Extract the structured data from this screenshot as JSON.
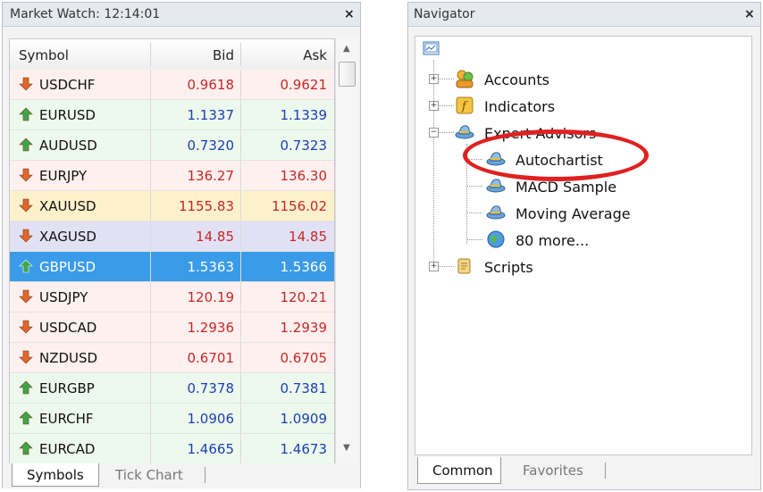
{
  "market_watch": {
    "title": "Market Watch: 12:14:01",
    "close_icon": "×",
    "columns": {
      "symbol": "Symbol",
      "bid": "Bid",
      "ask": "Ask"
    },
    "rows": [
      {
        "symbol": "USDCHF",
        "bid": "0.9618",
        "ask": "0.9621",
        "dir": "down"
      },
      {
        "symbol": "EURUSD",
        "bid": "1.1337",
        "ask": "1.1339",
        "dir": "up"
      },
      {
        "symbol": "AUDUSD",
        "bid": "0.7320",
        "ask": "0.7323",
        "dir": "up"
      },
      {
        "symbol": "EURJPY",
        "bid": "136.27",
        "ask": "136.30",
        "dir": "down"
      },
      {
        "symbol": "XAUUSD",
        "bid": "1155.83",
        "ask": "1156.02",
        "dir": "down"
      },
      {
        "symbol": "XAGUSD",
        "bid": "14.85",
        "ask": "14.85",
        "dir": "down"
      },
      {
        "symbol": "GBPUSD",
        "bid": "1.5363",
        "ask": "1.5366",
        "dir": "up"
      },
      {
        "symbol": "USDJPY",
        "bid": "120.19",
        "ask": "120.21",
        "dir": "down"
      },
      {
        "symbol": "USDCAD",
        "bid": "1.2936",
        "ask": "1.2939",
        "dir": "down"
      },
      {
        "symbol": "NZDUSD",
        "bid": "0.6701",
        "ask": "0.6705",
        "dir": "down"
      },
      {
        "symbol": "EURGBP",
        "bid": "0.7378",
        "ask": "0.7381",
        "dir": "up"
      },
      {
        "symbol": "EURCHF",
        "bid": "1.0906",
        "ask": "1.0909",
        "dir": "up"
      },
      {
        "symbol": "EURCAD",
        "bid": "1.4665",
        "ask": "1.4673",
        "dir": "up"
      }
    ],
    "tabs": {
      "active": "Symbols",
      "inactive": "Tick Chart"
    },
    "colors": {
      "up_bg": "#eef9ee",
      "down_bg": "#fdf0ee",
      "gold_bg": "#fdf1cc",
      "silver_bg": "#e2e1f3",
      "selected_bg": "#3a9be8",
      "up_text": "#1a3fb0",
      "down_text": "#c62828"
    }
  },
  "navigator": {
    "title": "Navigator",
    "close_icon": "×",
    "items": {
      "accounts": "Accounts",
      "indicators": "Indicators",
      "expert_advisors": "Expert Advisors",
      "autochartist": "Autochartist",
      "macd": "MACD Sample",
      "moving_average": "Moving Average",
      "more": "80 more...",
      "scripts": "Scripts"
    },
    "tabs": {
      "active": "Common",
      "inactive": "Favorites"
    },
    "highlight_color": "#e02020"
  }
}
